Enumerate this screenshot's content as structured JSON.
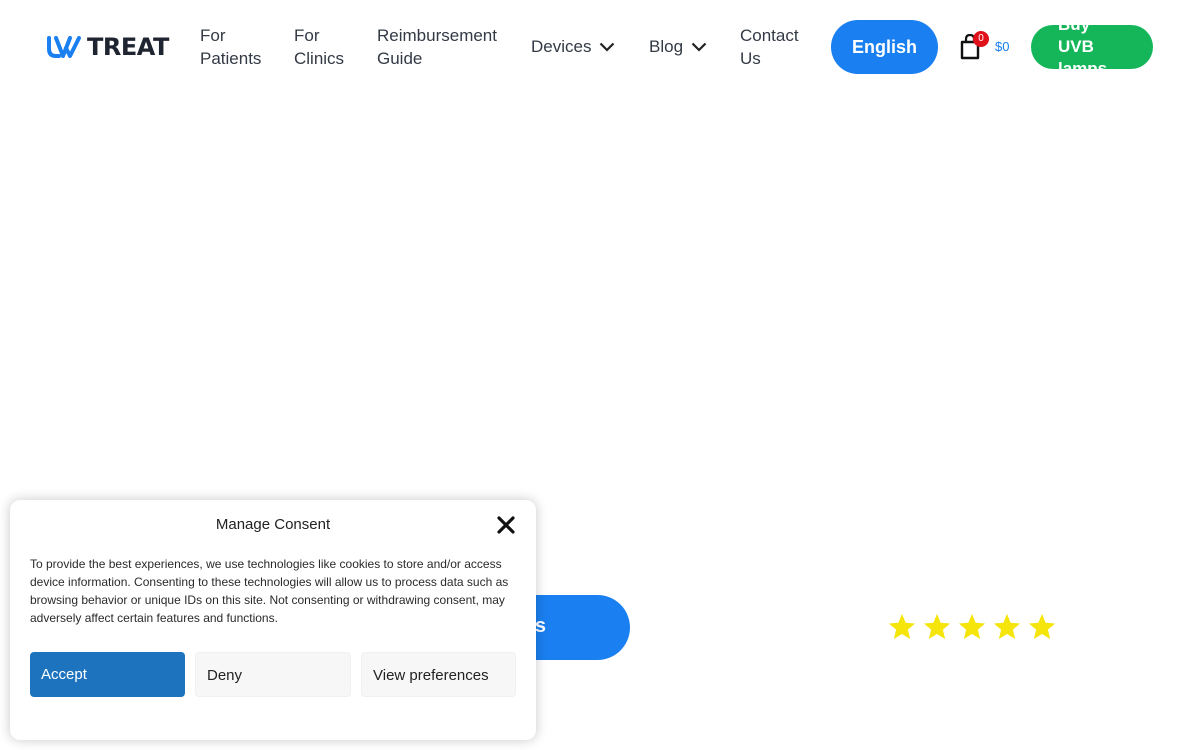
{
  "header": {
    "logo_text": "TREAT",
    "nav": [
      {
        "label_line1": "For",
        "label_line2": "Patients"
      },
      {
        "label_line1": "For",
        "label_line2": "Clinics"
      },
      {
        "label_line1": "Reimbursement",
        "label_line2": "Guide"
      },
      {
        "label": "Devices"
      },
      {
        "label": "Blog"
      },
      {
        "label_line1": "Contact",
        "label_line2": "Us"
      }
    ],
    "language_button": "English",
    "cart": {
      "count": "0",
      "total": "$0"
    },
    "buy_button": {
      "line1": "Buy",
      "line2": "UVB",
      "line3": "lamps"
    }
  },
  "hero": {
    "cta_partial_text": "s",
    "rating_stars": 5
  },
  "consent": {
    "title": "Manage Consent",
    "body": "To provide the best experiences, we use technologies like cookies to store and/or access device information. Consenting to these technologies will allow us to process data such as browsing behavior or unique IDs on this site. Not consenting or withdrawing consent, may adversely affect certain features and functions.",
    "accept_label": "Accept",
    "deny_label": "Deny",
    "preferences_label": "View preferences"
  },
  "colors": {
    "primary_blue": "#1a7ff0",
    "buy_green": "#15b65a",
    "accept_blue": "#1e73be",
    "badge_red": "#e0101a",
    "star_yellow": "#f5e50a"
  }
}
